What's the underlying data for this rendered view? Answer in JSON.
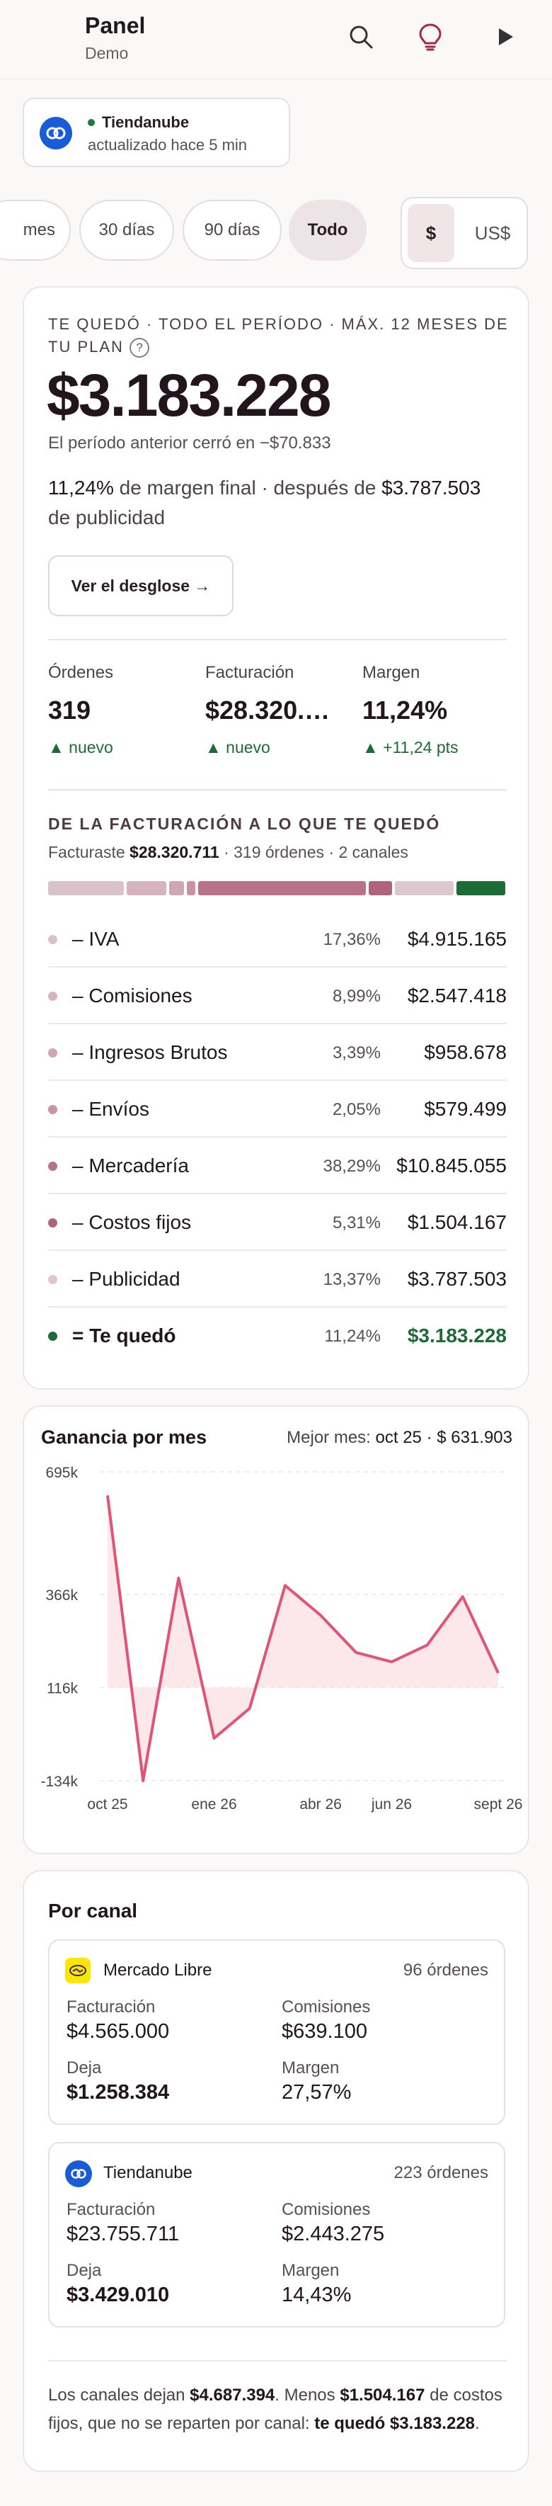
{
  "header": {
    "title": "Panel",
    "subtitle": "Demo"
  },
  "icons": {
    "search": "search-icon",
    "ideas": "lightbulb-icon",
    "play": "play-icon"
  },
  "store": {
    "name": "Tiendanube",
    "status": "actualizado hace 5 min",
    "status_color": "#1d7a3e"
  },
  "period_tabs": [
    {
      "label": "mes",
      "active": false
    },
    {
      "label": "30 días",
      "active": false
    },
    {
      "label": "90 días",
      "active": false
    },
    {
      "label": "Todo",
      "active": true
    }
  ],
  "currency": {
    "options": [
      "$",
      "US$"
    ],
    "selected": "$"
  },
  "summary": {
    "eyebrow": "TE QUEDÓ · TODO EL PERÍODO · MÁX. 12 MESES DE TU PLAN",
    "help": "?",
    "amount": "$3.183.228",
    "previous": "El período anterior cerró en −$70.833",
    "margin_pct": "11,24%",
    "margin_mid": " de margen final · después de ",
    "ads_amount": "$3.787.503",
    "margin_end": " de publicidad",
    "breakdown_button": "Ver el desglose →"
  },
  "kpis": [
    {
      "label": "Órdenes",
      "value": "319",
      "delta": "▲ nuevo"
    },
    {
      "label": "Facturación",
      "value": "$28.320.…",
      "delta": "▲ nuevo"
    },
    {
      "label": "Margen",
      "value": "11,24%",
      "delta": "▲ +11,24 pts"
    }
  ],
  "waterfall": {
    "title": "DE LA FACTURACIÓN A LO QUE TE QUEDÓ",
    "sub_prefix": "Facturaste ",
    "sub_amount": "$28.320.711",
    "sub_suffix": " · 319 órdenes · 2 canales",
    "rows": [
      {
        "label": "– IVA",
        "pct": "17,36%",
        "amount": "$4.915.165",
        "share": 17.36,
        "color": "#d9c2c9"
      },
      {
        "label": "– Comisiones",
        "pct": "8,99%",
        "amount": "$2.547.418",
        "share": 8.99,
        "color": "#d5b4bf"
      },
      {
        "label": "– Ingresos Brutos",
        "pct": "3,39%",
        "amount": "$958.678",
        "share": 3.39,
        "color": "#cfa7b4"
      },
      {
        "label": "– Envíos",
        "pct": "2,05%",
        "amount": "$579.499",
        "share": 2.05,
        "color": "#c993a4"
      },
      {
        "label": "– Mercadería",
        "pct": "38,29%",
        "amount": "$10.845.055",
        "share": 38.29,
        "color": "#b87389"
      },
      {
        "label": "– Costos fijos",
        "pct": "5,31%",
        "amount": "$1.504.167",
        "share": 5.31,
        "color": "#ad647c"
      },
      {
        "label": "– Publicidad",
        "pct": "13,37%",
        "amount": "$3.787.503",
        "share": 13.37,
        "color": "#dcc8ce"
      },
      {
        "label": "= Te quedó",
        "pct": "11,24%",
        "amount": "$3.183.228",
        "share": 11.24,
        "color": "#1d6b36"
      }
    ]
  },
  "profit_chart": {
    "title": "Ganancia por mes",
    "best_label": "Mejor mes: ",
    "best_value": "oct 25 · $ 631.903",
    "chart_data": {
      "type": "area",
      "x": [
        "oct 25",
        "nov 25",
        "dic 25",
        "ene 26",
        "feb 26",
        "mar 26",
        "abr 26",
        "may 26",
        "jun 26",
        "jul 26",
        "ago 26",
        "sept 26"
      ],
      "series": [
        {
          "values": [
            631903,
            -134000,
            410000,
            -20000,
            60000,
            390000,
            310000,
            210000,
            185000,
            230000,
            360000,
            155000
          ],
          "color": "#e05478"
        }
      ],
      "ylim": [
        -134000,
        695000
      ],
      "yticks": [
        {
          "v": 695000,
          "label": "695k"
        },
        {
          "v": 366000,
          "label": "366k"
        },
        {
          "v": 116000,
          "label": "116k"
        },
        {
          "v": -134000,
          "label": "-134k"
        }
      ],
      "xtick_labels": [
        "oct 25",
        "ene 26",
        "abr 26",
        "jun 26",
        "sept 26"
      ],
      "grid": true
    }
  },
  "channels": {
    "title": "Por canal",
    "items": [
      {
        "name": "Mercado Libre",
        "icon": "handshake-icon",
        "icon_color": "#ffe600",
        "orders": "96 órdenes",
        "fact_label": "Facturación",
        "fact": "$4.565.000",
        "com_label": "Comisiones",
        "com": "$639.100",
        "deja_label": "Deja",
        "deja": "$1.258.384",
        "margin_label": "Margen",
        "margin": "27,57%"
      },
      {
        "name": "Tiendanube",
        "icon": "cloud-icon",
        "icon_color": "#1a5cd6",
        "orders": "223 órdenes",
        "fact_label": "Facturación",
        "fact": "$23.755.711",
        "com_label": "Comisiones",
        "com": "$2.443.275",
        "deja_label": "Deja",
        "deja": "$3.429.010",
        "margin_label": "Margen",
        "margin": "14,43%"
      }
    ],
    "footer": {
      "p1": "Los canales dejan ",
      "b1": "$4.687.394",
      "p2": ". Menos ",
      "b2": "$1.504.167",
      "p3": " de costos fijos, que no se reparten por canal: ",
      "b3": "te quedó $3.183.228",
      "p4": "."
    }
  }
}
